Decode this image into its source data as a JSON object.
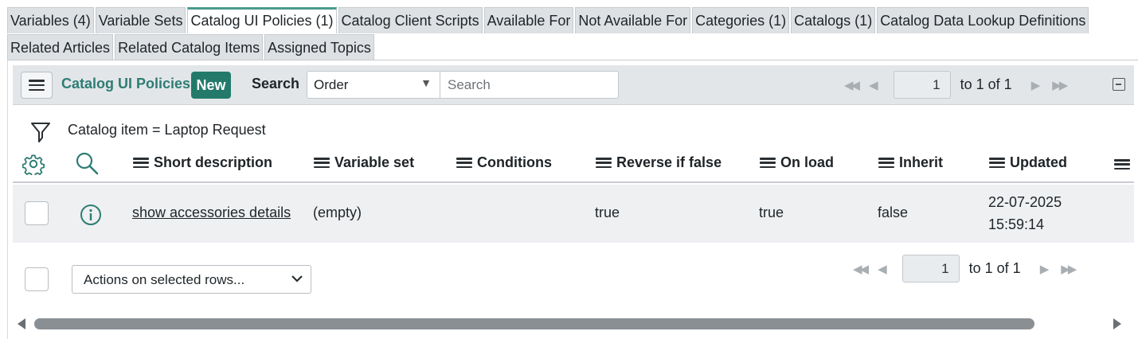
{
  "tabs": {
    "row1": [
      {
        "label": "Variables (4)",
        "active": false
      },
      {
        "label": "Variable Sets",
        "active": false
      },
      {
        "label": "Catalog UI Policies (1)",
        "active": true
      },
      {
        "label": "Catalog Client Scripts",
        "active": false
      },
      {
        "label": "Available For",
        "active": false
      },
      {
        "label": "Not Available For",
        "active": false
      },
      {
        "label": "Categories (1)",
        "active": false
      },
      {
        "label": "Catalogs (1)",
        "active": false
      },
      {
        "label": "Catalog Data Lookup Definitions",
        "active": false
      }
    ],
    "row2": [
      {
        "label": "Related Articles",
        "active": false
      },
      {
        "label": "Related Catalog Items",
        "active": false
      },
      {
        "label": "Assigned Topics",
        "active": false
      }
    ]
  },
  "header": {
    "title": "Catalog UI Policies",
    "new_label": "New",
    "search_label": "Search",
    "search_field": "Order",
    "search_placeholder": "Search"
  },
  "pager_top": {
    "page": "1",
    "range": "to 1 of 1"
  },
  "pager_bottom": {
    "page": "1",
    "range": "to 1 of 1"
  },
  "filter": {
    "breadcrumb": "Catalog item = Laptop Request"
  },
  "columns": [
    {
      "label": "Short description"
    },
    {
      "label": "Variable set"
    },
    {
      "label": "Conditions"
    },
    {
      "label": "Reverse if false"
    },
    {
      "label": "On load"
    },
    {
      "label": "Inherit"
    },
    {
      "label": "Updated"
    }
  ],
  "rows": [
    {
      "short_description": "show accessories details",
      "variable_set": "(empty)",
      "conditions": "",
      "reverse_if_false": "true",
      "on_load": "true",
      "inherit": "false",
      "updated_date": "22-07-2025",
      "updated_time": "15:59:14"
    }
  ],
  "footer": {
    "actions_label": "Actions on selected rows..."
  },
  "colors": {
    "accent": "#237a6b",
    "title": "#2e7d74",
    "active_tab_border": "#4a9b8c"
  },
  "icons": [
    "hamburger-icon",
    "filter-funnel-icon",
    "gear-icon",
    "magnifier-icon",
    "info-icon",
    "chevron-down-icon",
    "caret-down-icon"
  ]
}
